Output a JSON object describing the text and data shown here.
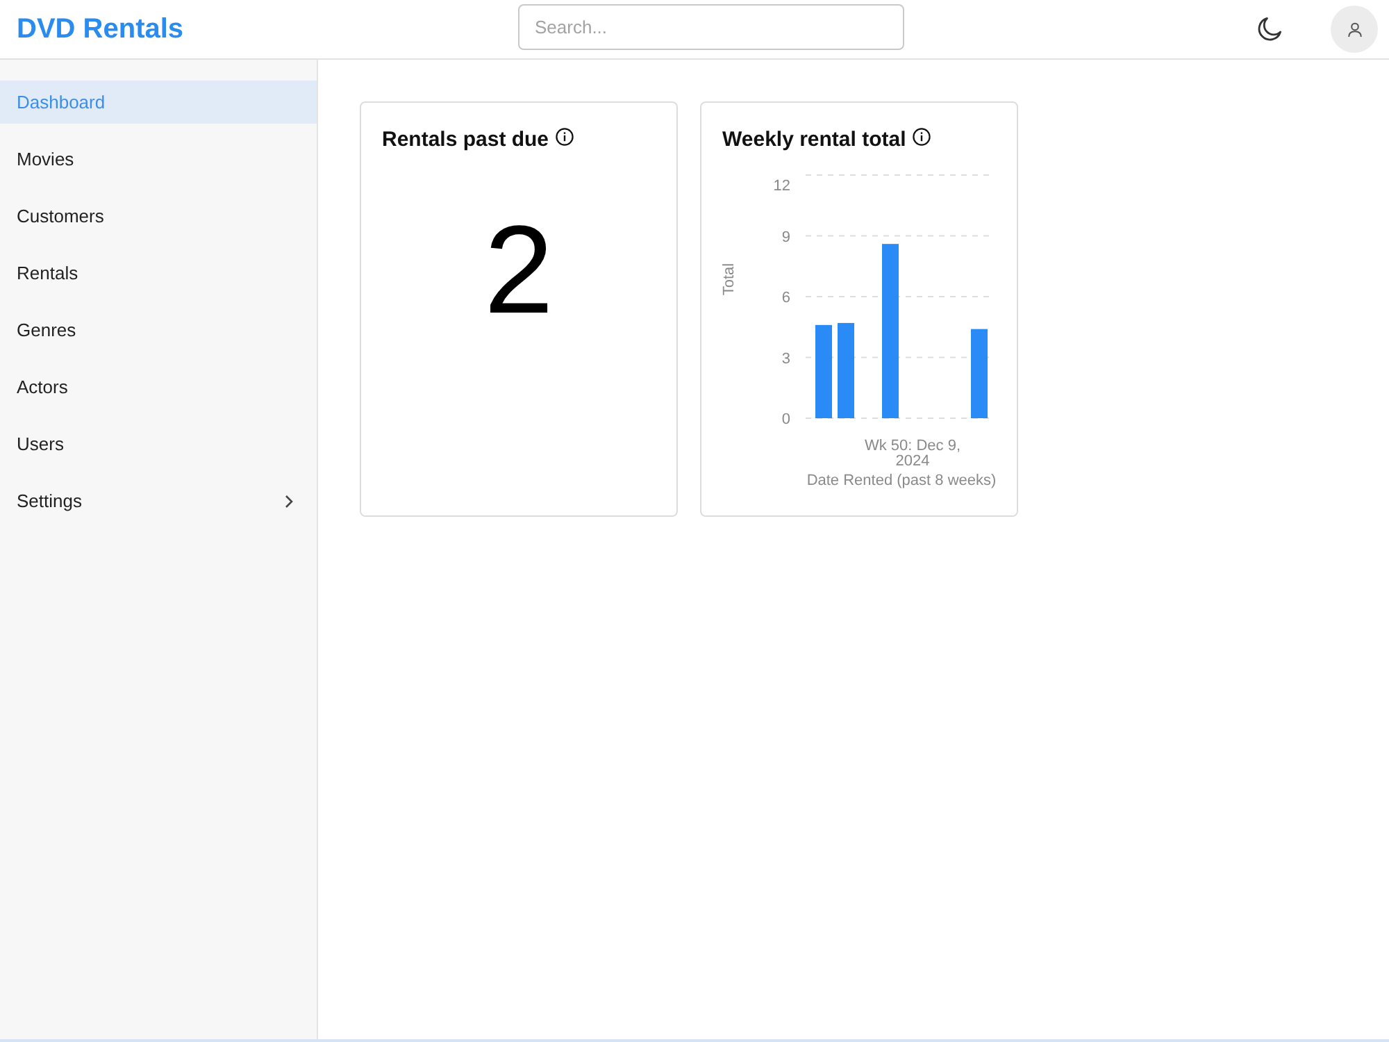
{
  "header": {
    "title": "DVD Rentals",
    "search": {
      "placeholder": "Search..."
    }
  },
  "sidebar": {
    "items": [
      {
        "label": "Dashboard",
        "selected": true,
        "kind": "link"
      },
      {
        "label": "Movies",
        "selected": false,
        "kind": "link"
      },
      {
        "label": "Customers",
        "selected": false,
        "kind": "link"
      },
      {
        "label": "Rentals",
        "selected": false,
        "kind": "link"
      },
      {
        "label": "Genres",
        "selected": false,
        "kind": "link"
      },
      {
        "label": "Actors",
        "selected": false,
        "kind": "link"
      },
      {
        "label": "Users",
        "selected": false,
        "kind": "link"
      },
      {
        "label": "Settings",
        "selected": false,
        "kind": "submenu"
      }
    ]
  },
  "cards": [
    {
      "kind": "stat",
      "title": "Rentals past due",
      "value": "2"
    },
    {
      "kind": "chart",
      "title": "Weekly rental total",
      "chart_data": {
        "type": "bar",
        "ylabel": "Total",
        "xlabel": "Date Rented (past 8 weeks)",
        "categories": [
          null,
          null,
          null,
          null,
          "Wk 50: Dec 9, 2024",
          null,
          null,
          null
        ],
        "series": [
          {
            "color": "#2a8af6",
            "values": [
              4.6,
              4.7,
              null,
              8.6,
              null,
              null,
              null,
              4.4
            ]
          }
        ],
        "ylim": [
          0,
          12
        ],
        "yticks": [
          0,
          3,
          6,
          9,
          12
        ],
        "grid": true
      }
    }
  ]
}
